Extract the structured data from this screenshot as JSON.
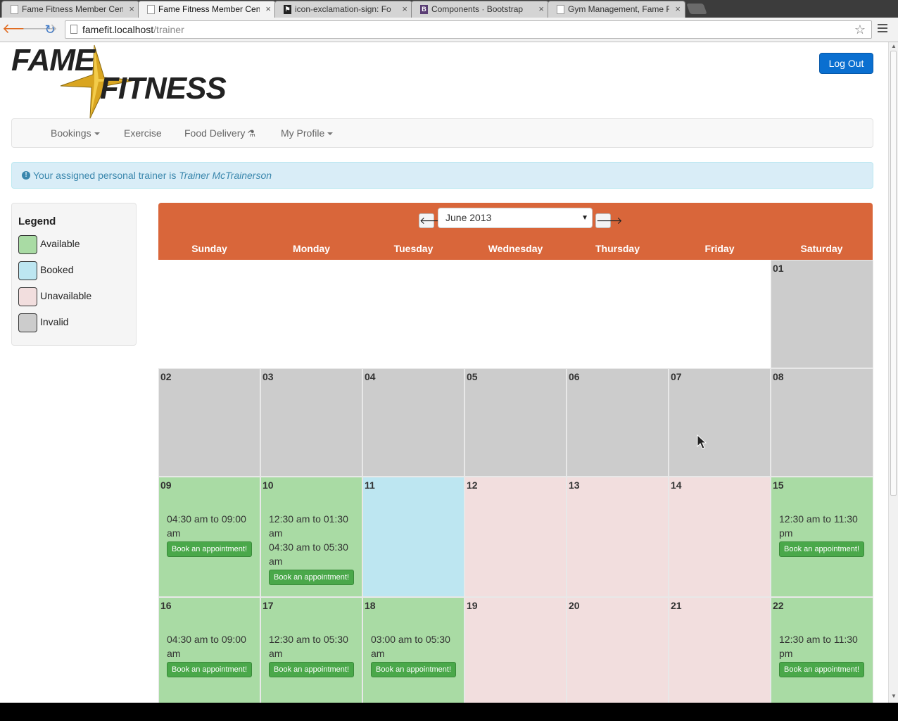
{
  "browser": {
    "tabs": [
      {
        "title": "Fame Fitness Member Cen",
        "icon": "page-icon",
        "active": false
      },
      {
        "title": "Fame Fitness Member Cen",
        "icon": "page-icon",
        "active": true
      },
      {
        "title": "icon-exclamation-sign: Fo",
        "icon": "flag-icon",
        "active": false
      },
      {
        "title": "Components · Bootstrap",
        "icon": "bootstrap-icon",
        "icon_text": "B",
        "active": false
      },
      {
        "title": "Gym Management, Fame F",
        "icon": "page-icon",
        "active": false
      }
    ],
    "address": {
      "host": "famefit.localhost",
      "path": "/trainer"
    }
  },
  "header": {
    "logo_top": "FAME",
    "logo_bottom": "FITNESS",
    "logout_label": "Log Out"
  },
  "nav": {
    "bookings": "Bookings",
    "exercise": "Exercise",
    "food_delivery": "Food Delivery",
    "my_profile": "My Profile"
  },
  "alert": {
    "prefix": "Your assigned personal trainer is",
    "trainer": "Trainer McTrainerson"
  },
  "legend": {
    "title": "Legend",
    "items": [
      {
        "label": "Available",
        "color": "#a9dba4"
      },
      {
        "label": "Booked",
        "color": "#bde6f1"
      },
      {
        "label": "Unavailable",
        "color": "#f2dede"
      },
      {
        "label": "Invalid",
        "color": "#cccccc"
      }
    ]
  },
  "calendar": {
    "month_label": "June 2013",
    "weekdays": [
      "Sunday",
      "Monday",
      "Tuesday",
      "Wednesday",
      "Thursday",
      "Friday",
      "Saturday"
    ],
    "status_colors": {
      "available": "#a9dba4",
      "booked": "#bde6f1",
      "unavailable": "#f2dede",
      "invalid": "#cccccc"
    },
    "book_label": "Book an appointment!",
    "weeks": [
      [
        {
          "day": "",
          "status": "empty"
        },
        {
          "day": "",
          "status": "empty"
        },
        {
          "day": "",
          "status": "empty"
        },
        {
          "day": "",
          "status": "empty"
        },
        {
          "day": "",
          "status": "empty"
        },
        {
          "day": "",
          "status": "empty"
        },
        {
          "day": "01",
          "status": "invalid"
        }
      ],
      [
        {
          "day": "02",
          "status": "invalid"
        },
        {
          "day": "03",
          "status": "invalid"
        },
        {
          "day": "04",
          "status": "invalid"
        },
        {
          "day": "05",
          "status": "invalid"
        },
        {
          "day": "06",
          "status": "invalid"
        },
        {
          "day": "07",
          "status": "invalid"
        },
        {
          "day": "08",
          "status": "invalid"
        }
      ],
      [
        {
          "day": "09",
          "status": "available",
          "slots": [
            "04:30 am to 09:00 am"
          ]
        },
        {
          "day": "10",
          "status": "available",
          "slots": [
            "12:30 am to 01:30 am",
            "04:30 am to 05:30 am"
          ]
        },
        {
          "day": "11",
          "status": "booked"
        },
        {
          "day": "12",
          "status": "unavailable"
        },
        {
          "day": "13",
          "status": "unavailable"
        },
        {
          "day": "14",
          "status": "unavailable"
        },
        {
          "day": "15",
          "status": "available",
          "slots": [
            "12:30 am to 11:30 pm"
          ]
        }
      ],
      [
        {
          "day": "16",
          "status": "available",
          "slots": [
            "04:30 am to 09:00 am"
          ]
        },
        {
          "day": "17",
          "status": "available",
          "slots": [
            "12:30 am to 05:30 am"
          ]
        },
        {
          "day": "18",
          "status": "available",
          "slots": [
            "03:00 am to 05:30 am"
          ]
        },
        {
          "day": "19",
          "status": "unavailable"
        },
        {
          "day": "20",
          "status": "unavailable"
        },
        {
          "day": "21",
          "status": "unavailable"
        },
        {
          "day": "22",
          "status": "available",
          "slots": [
            "12:30 am to 11:30 pm"
          ]
        }
      ]
    ]
  }
}
